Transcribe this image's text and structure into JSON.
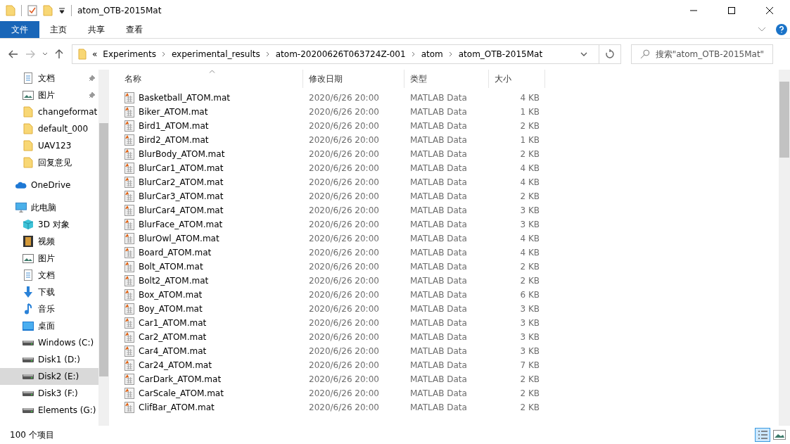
{
  "window": {
    "title": "atom_OTB-2015Mat"
  },
  "ribbon_tabs": [
    {
      "label": "文件",
      "selected": true
    },
    {
      "label": "主页",
      "selected": false
    },
    {
      "label": "共享",
      "selected": false
    },
    {
      "label": "查看",
      "selected": false
    }
  ],
  "address_bar": {
    "overflow": "«",
    "crumbs": [
      "Experiments",
      "experimental_results",
      "atom-20200626T063724Z-001",
      "atom",
      "atom_OTB-2015Mat"
    ]
  },
  "search": {
    "placeholder": "搜索\"atom_OTB-2015Mat\""
  },
  "sidebar": {
    "quick_access": [
      {
        "label": "文档",
        "kind": "doc",
        "pinned": true,
        "selected": false
      },
      {
        "label": "图片",
        "kind": "picture",
        "pinned": true,
        "selected": false
      },
      {
        "label": "changeformat",
        "kind": "folder",
        "pinned": false,
        "selected": false
      },
      {
        "label": "default_000",
        "kind": "folder",
        "pinned": false,
        "selected": false
      },
      {
        "label": "UAV123",
        "kind": "folder",
        "pinned": false,
        "selected": false
      },
      {
        "label": "回复意见",
        "kind": "folder",
        "pinned": false,
        "selected": false
      }
    ],
    "items": [
      {
        "label": "OneDrive",
        "kind": "cloud",
        "selected": false
      },
      {
        "label": "此电脑",
        "kind": "pc",
        "selected": false,
        "children": [
          {
            "label": "3D 对象",
            "kind": "cube",
            "selected": false
          },
          {
            "label": "视频",
            "kind": "video",
            "selected": false
          },
          {
            "label": "图片",
            "kind": "picture",
            "selected": false
          },
          {
            "label": "文档",
            "kind": "doc",
            "selected": false
          },
          {
            "label": "下载",
            "kind": "download",
            "selected": false
          },
          {
            "label": "音乐",
            "kind": "music",
            "selected": false
          },
          {
            "label": "桌面",
            "kind": "desktop",
            "selected": false
          },
          {
            "label": "Windows (C:)",
            "kind": "drive",
            "selected": false
          },
          {
            "label": "Disk1 (D:)",
            "kind": "drive",
            "selected": false
          },
          {
            "label": "Disk2 (E:)",
            "kind": "drive",
            "selected": true
          },
          {
            "label": "Disk3 (F:)",
            "kind": "drive",
            "selected": false
          },
          {
            "label": "Elements (G:)",
            "kind": "drive",
            "selected": false
          }
        ]
      }
    ]
  },
  "table": {
    "columns": [
      "名称",
      "修改日期",
      "类型",
      "大小"
    ],
    "rows": [
      [
        "Basketball_ATOM.mat",
        "2020/6/26 20:00",
        "MATLAB Data",
        "4 KB"
      ],
      [
        "Biker_ATOM.mat",
        "2020/6/26 20:00",
        "MATLAB Data",
        "1 KB"
      ],
      [
        "Bird1_ATOM.mat",
        "2020/6/26 20:00",
        "MATLAB Data",
        "2 KB"
      ],
      [
        "Bird2_ATOM.mat",
        "2020/6/26 20:00",
        "MATLAB Data",
        "1 KB"
      ],
      [
        "BlurBody_ATOM.mat",
        "2020/6/26 20:00",
        "MATLAB Data",
        "2 KB"
      ],
      [
        "BlurCar1_ATOM.mat",
        "2020/6/26 20:00",
        "MATLAB Data",
        "4 KB"
      ],
      [
        "BlurCar2_ATOM.mat",
        "2020/6/26 20:00",
        "MATLAB Data",
        "4 KB"
      ],
      [
        "BlurCar3_ATOM.mat",
        "2020/6/26 20:00",
        "MATLAB Data",
        "2 KB"
      ],
      [
        "BlurCar4_ATOM.mat",
        "2020/6/26 20:00",
        "MATLAB Data",
        "3 KB"
      ],
      [
        "BlurFace_ATOM.mat",
        "2020/6/26 20:00",
        "MATLAB Data",
        "3 KB"
      ],
      [
        "BlurOwl_ATOM.mat",
        "2020/6/26 20:00",
        "MATLAB Data",
        "4 KB"
      ],
      [
        "Board_ATOM.mat",
        "2020/6/26 20:00",
        "MATLAB Data",
        "4 KB"
      ],
      [
        "Bolt_ATOM.mat",
        "2020/6/26 20:00",
        "MATLAB Data",
        "2 KB"
      ],
      [
        "Bolt2_ATOM.mat",
        "2020/6/26 20:00",
        "MATLAB Data",
        "2 KB"
      ],
      [
        "Box_ATOM.mat",
        "2020/6/26 20:00",
        "MATLAB Data",
        "6 KB"
      ],
      [
        "Boy_ATOM.mat",
        "2020/6/26 20:00",
        "MATLAB Data",
        "3 KB"
      ],
      [
        "Car1_ATOM.mat",
        "2020/6/26 20:00",
        "MATLAB Data",
        "3 KB"
      ],
      [
        "Car2_ATOM.mat",
        "2020/6/26 20:00",
        "MATLAB Data",
        "3 KB"
      ],
      [
        "Car4_ATOM.mat",
        "2020/6/26 20:00",
        "MATLAB Data",
        "3 KB"
      ],
      [
        "Car24_ATOM.mat",
        "2020/6/26 20:00",
        "MATLAB Data",
        "7 KB"
      ],
      [
        "CarDark_ATOM.mat",
        "2020/6/26 20:00",
        "MATLAB Data",
        "2 KB"
      ],
      [
        "CarScale_ATOM.mat",
        "2020/6/26 20:00",
        "MATLAB Data",
        "2 KB"
      ],
      [
        "ClifBar_ATOM.mat",
        "2020/6/26 20:00",
        "MATLAB Data",
        "2 KB"
      ]
    ]
  },
  "status_bar": {
    "item_count": "100 个项目"
  }
}
